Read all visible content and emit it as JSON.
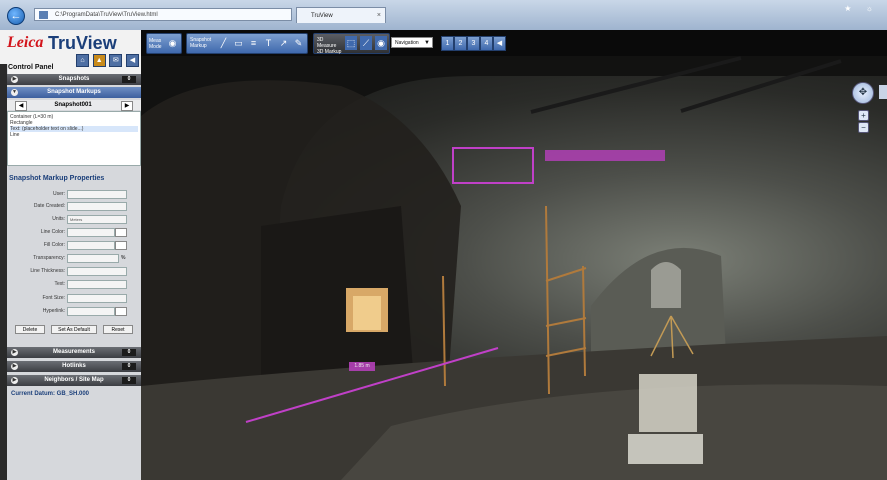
{
  "browser": {
    "address": "C:\\ProgramData\\TruView\\TruView.html",
    "tab_title": "TruView",
    "tab_close": "×",
    "back_glyph": "←",
    "window_controls": "★ ☼"
  },
  "app": {
    "brand_leica": "Leica",
    "brand_name": "TruView"
  },
  "toolbar": {
    "view_mode_label": "Meas Mode",
    "markup_label": "Snapshot Markup",
    "tool_glyphs": [
      "╱",
      "▭",
      "≡",
      "T",
      "↗",
      "✎"
    ],
    "measure_label": "3D Measure 3D Markup",
    "mode_select": "Navigation",
    "page_buttons": [
      "1",
      "2",
      "3",
      "4"
    ]
  },
  "panel": {
    "title": "Control Panel",
    "icon_glyphs": [
      "⌂",
      "▲",
      "✉",
      "◀"
    ],
    "sections": {
      "snapshots": {
        "label": "Snapshots",
        "badge": "0"
      },
      "snapshot_markups": {
        "label": "Snapshot Markups"
      },
      "measurements": {
        "label": "Measurements",
        "badge": "0"
      },
      "hotlinks": {
        "label": "Hotlinks",
        "badge": "0"
      },
      "neighbor_sites": {
        "label": "Neighbors / Site Map",
        "badge": "0"
      }
    },
    "markup_nav": {
      "prev": "◀",
      "next": "▶",
      "label": "Snapshot001"
    },
    "markup_list": [
      "Container (L=30 m)",
      "Rectangle",
      "Text: (placeholder text on slide...)",
      "Line"
    ],
    "markup_props": {
      "title": "Snapshot Markup Properties",
      "fields": [
        {
          "label": "User:",
          "value": ""
        },
        {
          "label": "Date Created:",
          "value": ""
        },
        {
          "label": "Units:",
          "value": "Meters"
        },
        {
          "label": "Line Color:",
          "value": ""
        },
        {
          "label": "Fill Color:",
          "value": ""
        },
        {
          "label": "Transparency:",
          "value": ""
        },
        {
          "label": "Line Thickness:",
          "value": ""
        },
        {
          "label": "Text:",
          "value": ""
        },
        {
          "label": "Font Size:",
          "value": ""
        },
        {
          "label": "Hyperlink:",
          "value": ""
        }
      ],
      "pct": "%",
      "buttons": [
        "Delete",
        "Set As Default",
        "Reset"
      ]
    },
    "current_datum": "Current Datum: GB_SH.000"
  },
  "scene": {
    "markup_line_label": "1.85 m",
    "nav_glyph": "✥",
    "zoom_in": "+",
    "zoom_out": "−",
    "markup_color": "#c040c8",
    "text_box_color": "#b040b5"
  }
}
